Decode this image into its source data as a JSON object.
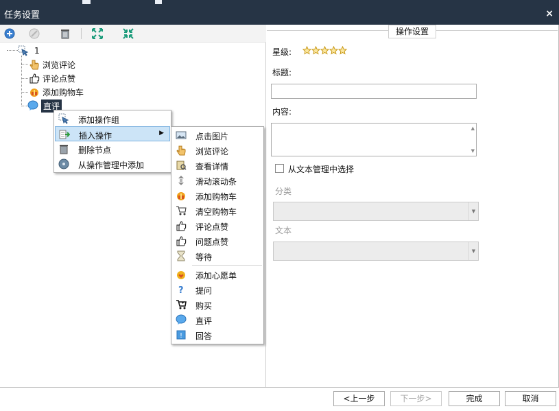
{
  "window": {
    "title": "任务设置",
    "close_label": "×"
  },
  "toolbar": {
    "buttons": [
      {
        "icon": "add-circle-icon"
      },
      {
        "icon": "disabled-circle-icon"
      },
      {
        "icon": "trash-icon"
      },
      {
        "icon": "expand-icon"
      },
      {
        "icon": "collapse-icon"
      }
    ]
  },
  "tree": {
    "root_label": "1",
    "items": [
      {
        "label": "浏览评论",
        "icon": "hand-pointer-icon"
      },
      {
        "label": "评论点赞",
        "icon": "thumbs-up-icon"
      },
      {
        "label": "添加购物车",
        "icon": "gift-icon"
      },
      {
        "label": "直评",
        "icon": "chat-bubble-icon",
        "selected": true
      }
    ]
  },
  "context_menu": {
    "items": [
      {
        "label": "添加操作组",
        "icon": "cursor-icon"
      },
      {
        "label": "插入操作",
        "icon": "insert-icon",
        "has_submenu": true,
        "highlighted": true
      },
      {
        "label": "删除节点",
        "icon": "trash-icon"
      },
      {
        "label": "从操作管理中添加",
        "icon": "disk-icon"
      }
    ],
    "submenu_arrow": "▶"
  },
  "submenu": {
    "items": [
      {
        "label": "点击图片",
        "icon": "image-icon"
      },
      {
        "label": "浏览评论",
        "icon": "hand-pointer-icon"
      },
      {
        "label": "查看详情",
        "icon": "details-icon"
      },
      {
        "label": "滑动滚动条",
        "icon": "scroll-icon"
      },
      {
        "label": "添加购物车",
        "icon": "gift-icon"
      },
      {
        "label": "清空购物车",
        "icon": "empty-cart-icon"
      },
      {
        "label": "评论点赞",
        "icon": "thumbs-up-icon"
      },
      {
        "label": "问题点赞",
        "icon": "thumbs-up-icon"
      },
      {
        "label": "等待",
        "icon": "hourglass-icon"
      },
      {
        "label": "添加心愿单",
        "icon": "wishlist-icon"
      },
      {
        "label": "提问",
        "icon": "question-icon"
      },
      {
        "label": "购买",
        "icon": "cart-icon"
      },
      {
        "label": "直评",
        "icon": "chat-bubble-icon"
      },
      {
        "label": "回答",
        "icon": "answer-icon"
      }
    ]
  },
  "settings": {
    "group_title": "操作设置",
    "rating_label": "星级:",
    "stars": 5,
    "title_label": "标题:",
    "title_value": "",
    "content_label": "内容:",
    "content_value": "",
    "checkbox_label": "从文本管理中选择",
    "checkbox_checked": false,
    "category_label": "分类",
    "category_value": "",
    "text_label": "文本",
    "text_value": ""
  },
  "footer": {
    "prev_label": "<上一步",
    "next_label": "下一步>",
    "finish_label": "完成",
    "cancel_label": "取消"
  }
}
